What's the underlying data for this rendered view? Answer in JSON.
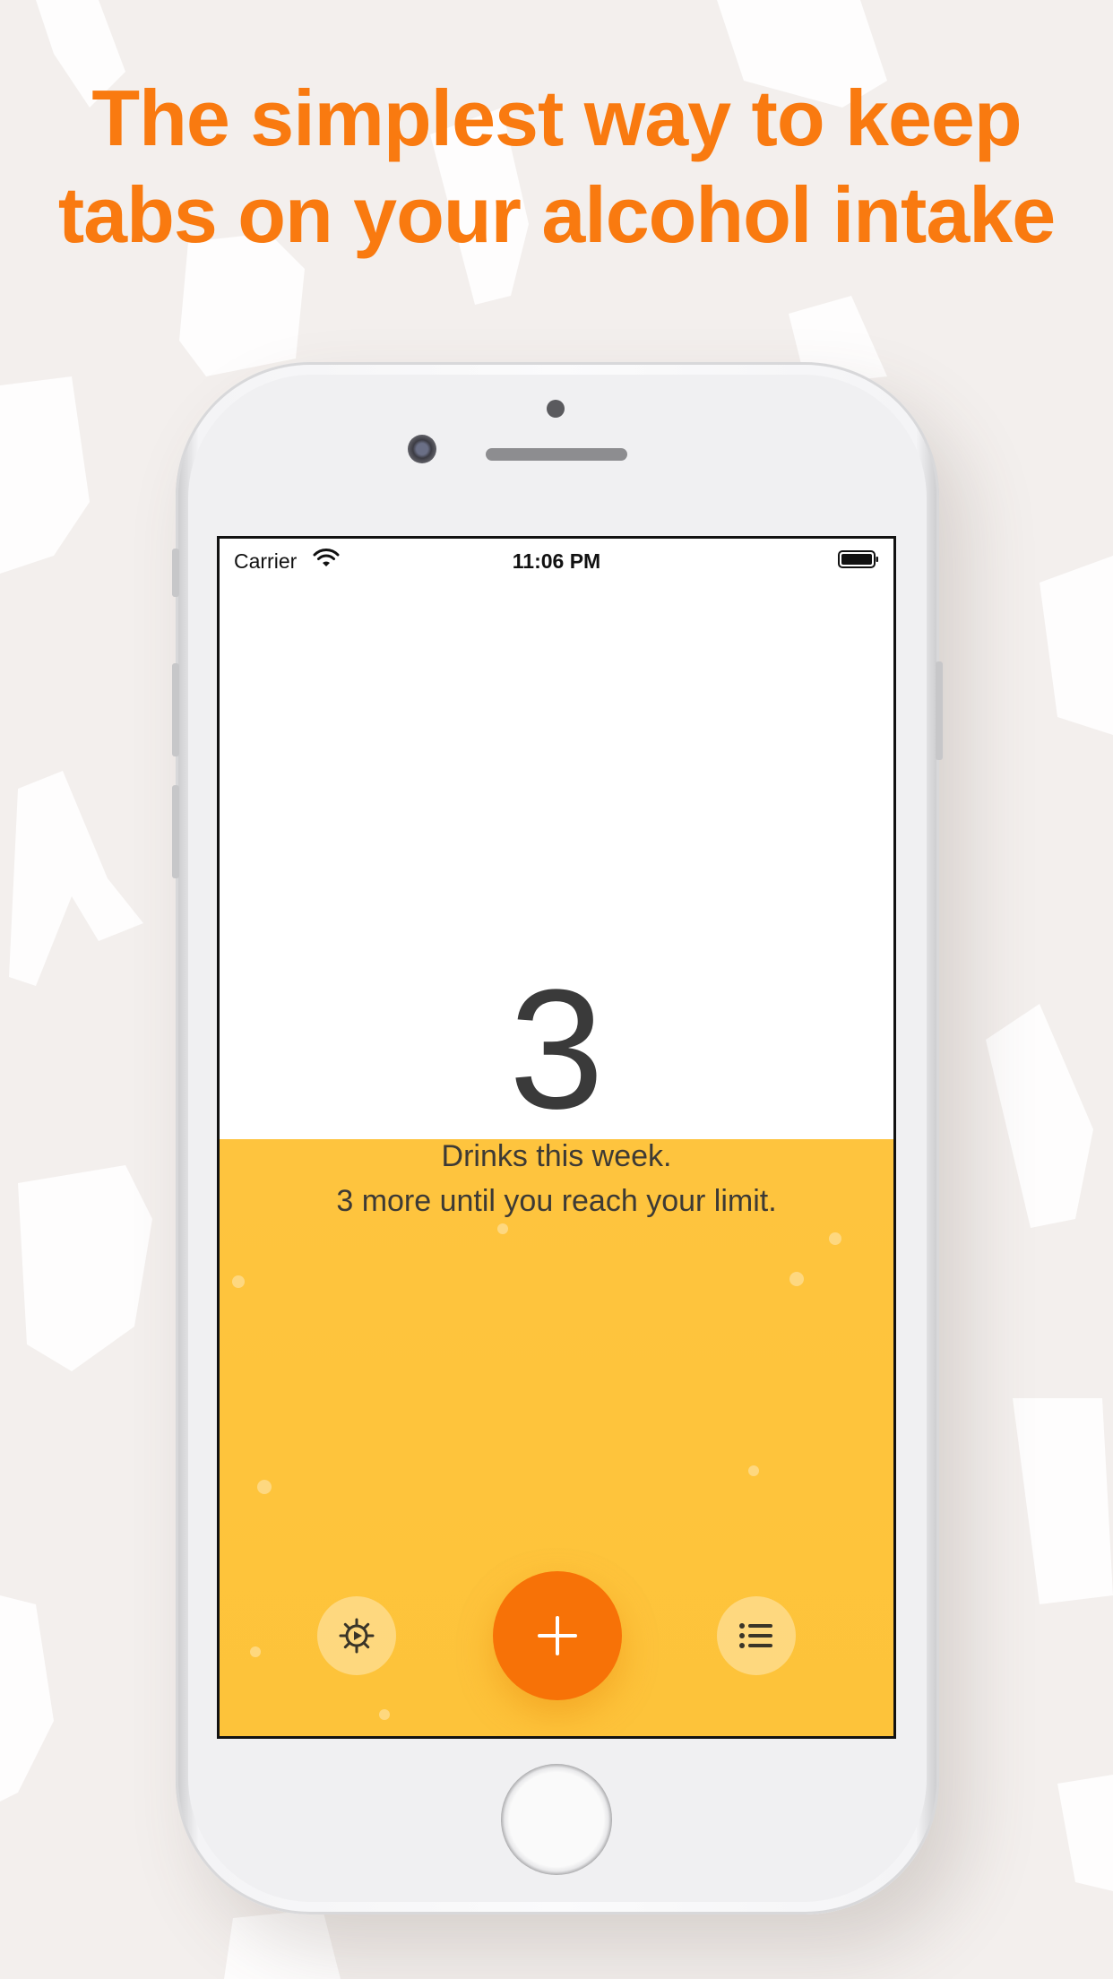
{
  "headline": {
    "line1": "The simplest way to keep",
    "line2": "tabs on your alcohol intake"
  },
  "status_bar": {
    "carrier": "Carrier",
    "time": "11:06 PM",
    "icons": [
      "wifi-icon",
      "battery-icon"
    ]
  },
  "counter": {
    "value": "3",
    "label": "Drinks this week.",
    "remaining": "3 more until you reach your limit."
  },
  "toolbar": {
    "settings_icon": "gear-icon",
    "add_icon": "plus-icon",
    "list_icon": "list-icon"
  },
  "colors": {
    "accent": "#f77207",
    "headline": "#f97a10",
    "beer": "#fec43e",
    "background": "#f3efed"
  }
}
